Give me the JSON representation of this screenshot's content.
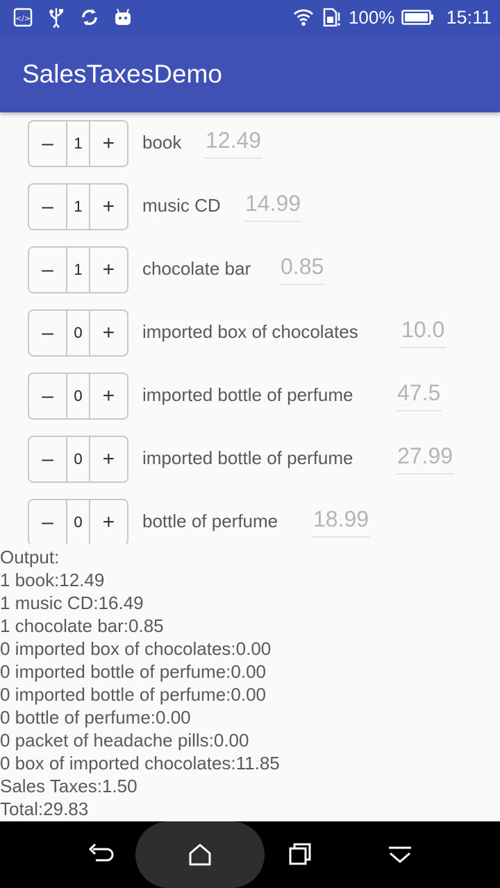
{
  "status_bar": {
    "battery_percent": "100%",
    "time": "15:11",
    "icons": [
      "code-icon",
      "usb-icon",
      "sync-icon",
      "android-icon",
      "wifi-icon",
      "sim-icon",
      "battery-icon"
    ]
  },
  "app": {
    "title": "SalesTaxesDemo"
  },
  "items": [
    {
      "qty": "1",
      "name": "book",
      "price": "12.49"
    },
    {
      "qty": "1",
      "name": "music CD",
      "price": "14.99"
    },
    {
      "qty": "1",
      "name": "chocolate bar",
      "price": "0.85"
    },
    {
      "qty": "0",
      "name": "imported box of chocolates",
      "price": "10.0"
    },
    {
      "qty": "0",
      "name": "imported bottle of perfume",
      "price": "47.5"
    },
    {
      "qty": "0",
      "name": "imported bottle of perfume",
      "price": "27.99"
    },
    {
      "qty": "0",
      "name": "bottle of perfume",
      "price": "18.99"
    }
  ],
  "stepper": {
    "minus_label": "–",
    "plus_label": "+"
  },
  "output": {
    "label": "Output:",
    "lines": [
      "1 book:12.49",
      "1 music CD:16.49",
      "1 chocolate bar:0.85",
      "0 imported box of chocolates:0.00",
      "0 imported bottle of perfume:0.00",
      "0 imported bottle of perfume:0.00",
      "0 bottle of perfume:0.00",
      "0 packet of headache pills:0.00",
      "0 box of imported chocolates:11.85"
    ],
    "sales_taxes": "Sales Taxes:1.50",
    "total": "Total:29.83"
  },
  "nav_bar": {
    "icons": [
      "back-icon",
      "home-icon",
      "recents-icon",
      "hide-nav-icon"
    ]
  },
  "colors": {
    "status_bar": "#3a4fb3",
    "app_bar": "#3f51b5",
    "background": "#fafafa"
  }
}
